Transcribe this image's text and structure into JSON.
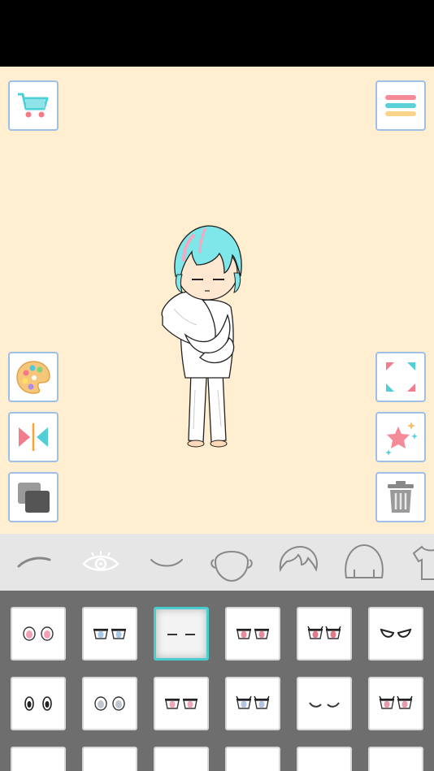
{
  "toolbar_left": [
    {
      "icon": "shopping-cart-icon"
    },
    {
      "icon": "color-palette-icon"
    },
    {
      "icon": "mirror-flip-icon"
    },
    {
      "icon": "layers-icon"
    }
  ],
  "toolbar_right": [
    {
      "icon": "menu-icon"
    },
    {
      "icon": "fullscreen-icon"
    },
    {
      "icon": "star-sparkle-icon"
    },
    {
      "icon": "trash-icon"
    }
  ],
  "categories": [
    {
      "icon": "eyebrow-icon",
      "selected": false
    },
    {
      "icon": "eye-icon",
      "selected": true
    },
    {
      "icon": "mouth-icon",
      "selected": false
    },
    {
      "icon": "head-icon",
      "selected": false
    },
    {
      "icon": "front-hair-icon",
      "selected": false
    },
    {
      "icon": "back-hair-icon",
      "selected": false
    },
    {
      "icon": "shirt-icon",
      "selected": false
    }
  ],
  "eye_options": [
    {
      "style": "round-pink",
      "selected": false
    },
    {
      "style": "half-blue",
      "selected": false
    },
    {
      "style": "closed-lines",
      "selected": true
    },
    {
      "style": "half-red",
      "selected": false
    },
    {
      "style": "lashes-red",
      "selected": false
    },
    {
      "style": "white-angry",
      "selected": false
    },
    {
      "style": "dot-black",
      "selected": false
    },
    {
      "style": "round-gray",
      "selected": false
    },
    {
      "style": "half-pink",
      "selected": false
    },
    {
      "style": "lashes-blue",
      "selected": false
    },
    {
      "style": "sleepy-curves",
      "selected": false
    },
    {
      "style": "lashes-pink",
      "selected": false
    }
  ],
  "colors": {
    "stage_bg": "#ffeecf",
    "button_border": "#9fbfe6",
    "selected_border": "#48cdd1",
    "hair": "#7fe6ea",
    "hair_highlight": "#f7a8c0",
    "grid_bg": "#6e6e6e",
    "category_bg": "#e6e6e6"
  }
}
